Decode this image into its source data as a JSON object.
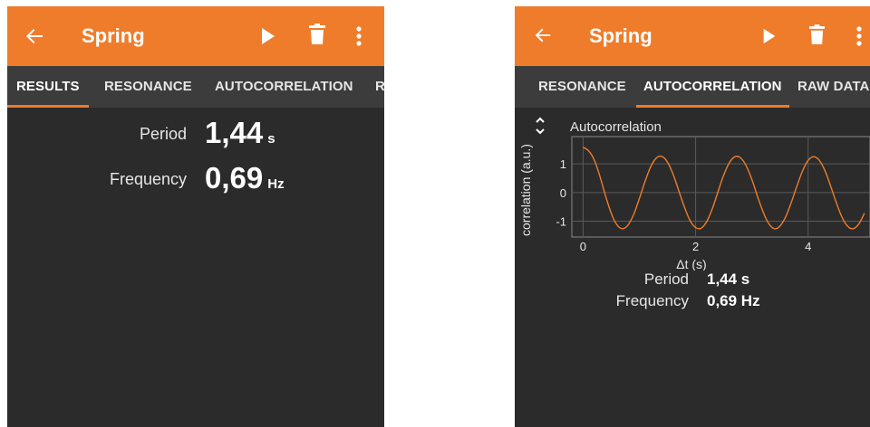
{
  "left_screen": {
    "app_bar": {
      "title": "Spring",
      "icons": [
        "back-arrow-icon",
        "play-icon",
        "trash-icon",
        "overflow-menu-icon"
      ]
    },
    "tabs": [
      {
        "label": "RESULTS",
        "active": true
      },
      {
        "label": "RESONANCE",
        "active": false
      },
      {
        "label": "AUTOCORRELATION",
        "active": false
      },
      {
        "label": "R",
        "active": false
      }
    ],
    "results": {
      "period_label": "Period",
      "period_value": "1,44",
      "period_unit": "s",
      "frequency_label": "Frequency",
      "frequency_value": "0,69",
      "frequency_unit": "Hz"
    }
  },
  "right_screen": {
    "app_bar": {
      "title": "Spring",
      "icons": [
        "back-arrow-icon",
        "play-icon",
        "trash-icon",
        "overflow-menu-icon"
      ]
    },
    "tabs": [
      {
        "label": "RESONANCE",
        "active": false
      },
      {
        "label": "AUTOCORRELATION",
        "active": true
      },
      {
        "label": "RAW DATA",
        "active": false
      }
    ],
    "results": {
      "period_label": "Period",
      "period_value": "1,44 s",
      "frequency_label": "Frequency",
      "frequency_value": "0,69 Hz"
    }
  },
  "colors": {
    "accent": "#ef7c2a",
    "background": "#2b2b2b",
    "tab_bar": "#3c3c3c",
    "curve": "#ef7c2a"
  },
  "chart_data": {
    "type": "line",
    "title": "Autocorrelation",
    "xlabel": "Δt (s)",
    "ylabel": "correlation (a.u.)",
    "x_ticks": [
      "0",
      "2",
      "4"
    ],
    "y_ticks": [
      "1",
      "0",
      "-1"
    ],
    "xlim": [
      -0.2,
      5.1
    ],
    "ylim": [
      -1.55,
      1.95
    ],
    "grid": true,
    "series": [
      {
        "x": [
          0.0,
          0.1,
          0.2,
          0.3,
          0.4,
          0.5,
          0.6,
          0.7,
          0.8,
          0.9,
          1.0,
          1.1,
          1.2,
          1.3,
          1.4,
          1.5,
          1.6,
          1.7,
          1.8,
          1.9,
          2.0,
          2.1,
          2.2,
          2.3,
          2.4,
          2.5,
          2.6,
          2.7,
          2.8,
          2.9,
          3.0,
          3.1,
          3.2,
          3.3,
          3.4,
          3.5,
          3.6,
          3.7,
          3.8,
          3.9,
          4.0,
          4.1,
          4.2,
          4.3,
          4.4,
          4.5,
          4.6,
          4.7,
          4.8,
          4.9,
          5.0
        ],
        "values": [
          1.58,
          1.45,
          1.13,
          0.56,
          -0.12,
          -0.72,
          -1.12,
          -1.26,
          -1.13,
          -0.76,
          -0.21,
          0.38,
          0.89,
          1.2,
          1.26,
          1.06,
          0.64,
          0.07,
          -0.5,
          -0.97,
          -1.22,
          -1.24,
          -1.0,
          -0.55,
          0.04,
          0.61,
          1.04,
          1.25,
          1.21,
          0.93,
          0.46,
          -0.13,
          -0.68,
          -1.08,
          -1.26,
          -1.17,
          -0.85,
          -0.35,
          0.22,
          0.75,
          1.12,
          1.25,
          1.12,
          0.76,
          0.23,
          -0.35,
          -0.85,
          -1.17,
          -1.26,
          -1.1,
          -0.72
        ]
      }
    ]
  }
}
